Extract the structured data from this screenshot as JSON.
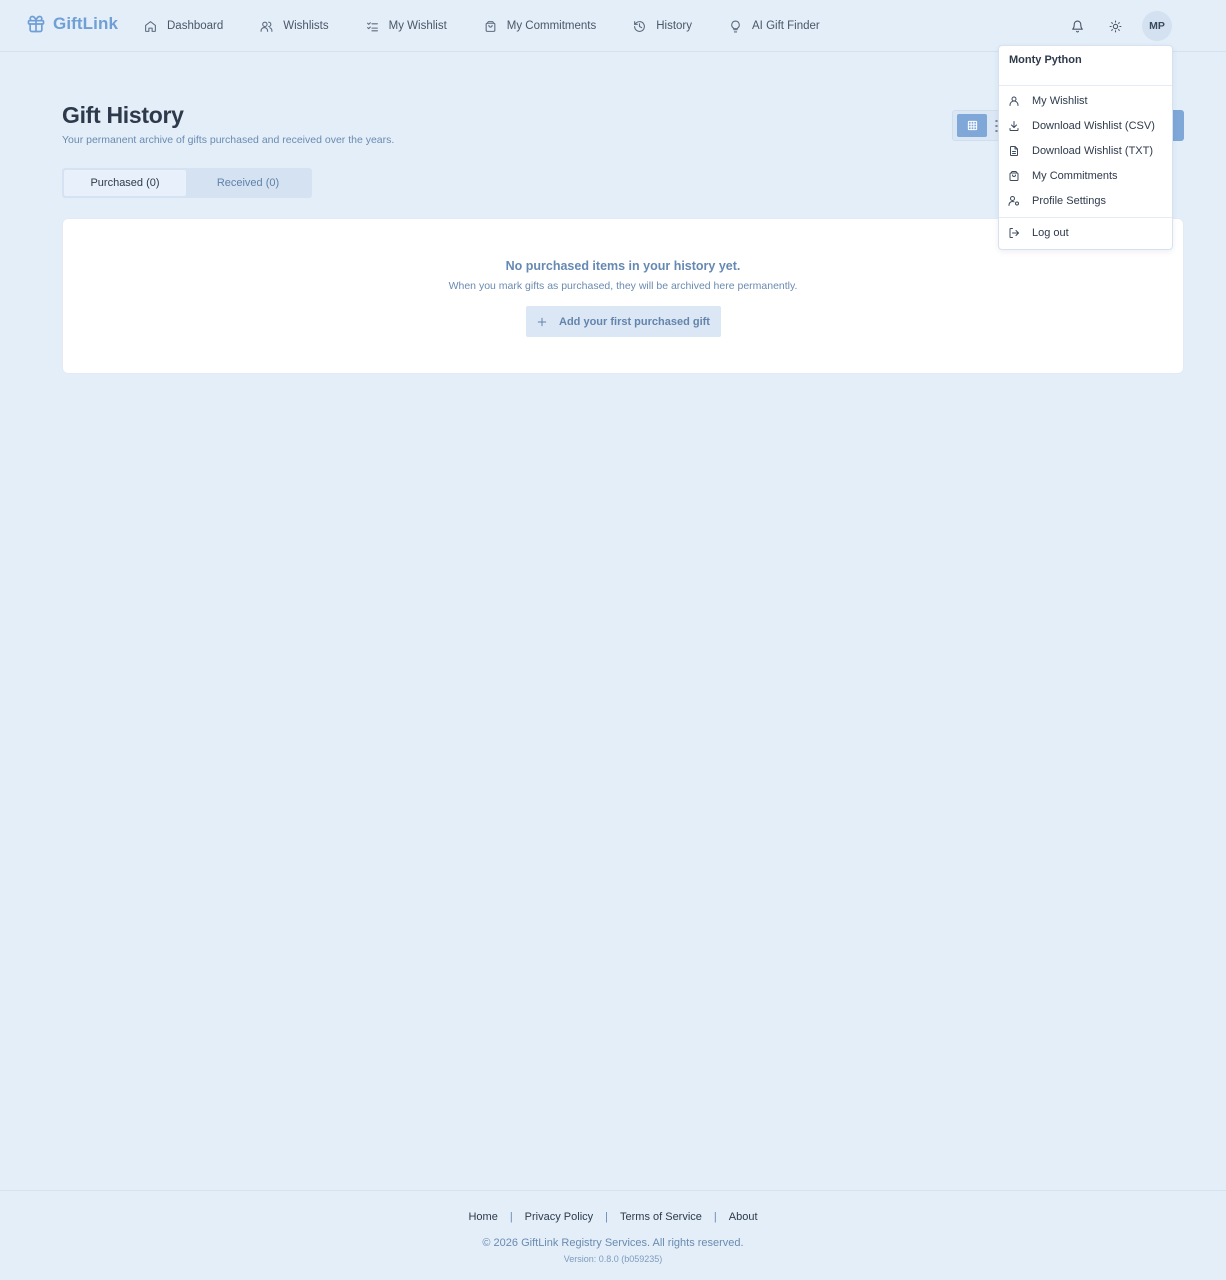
{
  "brand": {
    "name": "GiftLink"
  },
  "nav": {
    "items": [
      {
        "label": "Dashboard",
        "icon": "home-icon"
      },
      {
        "label": "Wishlists",
        "icon": "users-icon"
      },
      {
        "label": "My Wishlist",
        "icon": "list-check-icon"
      },
      {
        "label": "My Commitments",
        "icon": "shopping-bag-icon"
      },
      {
        "label": "History",
        "icon": "history-icon"
      },
      {
        "label": "AI Gift Finder",
        "icon": "lightbulb-icon"
      }
    ],
    "avatar_initials": "MP"
  },
  "header": {
    "title": "Gift History",
    "subtitle": "Your permanent archive of gifts purchased and received over the years."
  },
  "tabs": [
    {
      "label": "Purchased (0)",
      "active": true
    },
    {
      "label": "Received (0)",
      "active": false
    }
  ],
  "empty_state": {
    "title": "No purchased items in your history yet.",
    "subtitle": "When you mark gifts as purchased, they will be archived here permanently.",
    "button_label": "Add your first purchased gift"
  },
  "user_menu": {
    "user_name": "Monty Python",
    "items": [
      {
        "label": "My Wishlist",
        "icon": "user-icon"
      },
      {
        "label": "Download Wishlist (CSV)",
        "icon": "download-icon"
      },
      {
        "label": "Download Wishlist (TXT)",
        "icon": "file-text-icon"
      },
      {
        "label": "My Commitments",
        "icon": "shopping-bag-icon"
      },
      {
        "label": "Profile Settings",
        "icon": "user-cog-icon"
      }
    ],
    "logout_label": "Log out"
  },
  "footer": {
    "links": [
      "Home",
      "Privacy Policy",
      "Terms of Service",
      "About"
    ],
    "separator": "|",
    "copyright": "© 2026 GiftLink Registry Services. All rights reserved.",
    "version": "Version: 0.8.0 (b059235)"
  },
  "colors": {
    "background": "#e3eef9",
    "accent": "#7fa7d8",
    "brand": "#6f9fd4",
    "muted_text": "#6a8bb0"
  }
}
